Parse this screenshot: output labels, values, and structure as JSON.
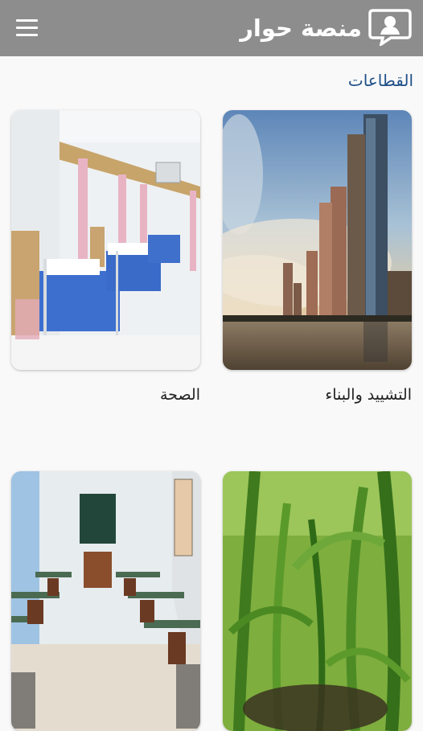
{
  "header": {
    "brand_title": "منصة حوار",
    "menu_icon": "hamburger-menu-icon",
    "logo_icon": "dialogue-person-icon",
    "background": "#8d8d8d"
  },
  "section": {
    "title": "القطاعات",
    "title_color": "#1e4f87"
  },
  "sectors": [
    {
      "label": "التشييد والبناء",
      "image": "city-skyline-river"
    },
    {
      "label": "الصحة",
      "image": "hospital-ward-beds"
    },
    {
      "label": "",
      "image": "corn-field"
    },
    {
      "label": "",
      "image": "classroom-desks"
    }
  ]
}
